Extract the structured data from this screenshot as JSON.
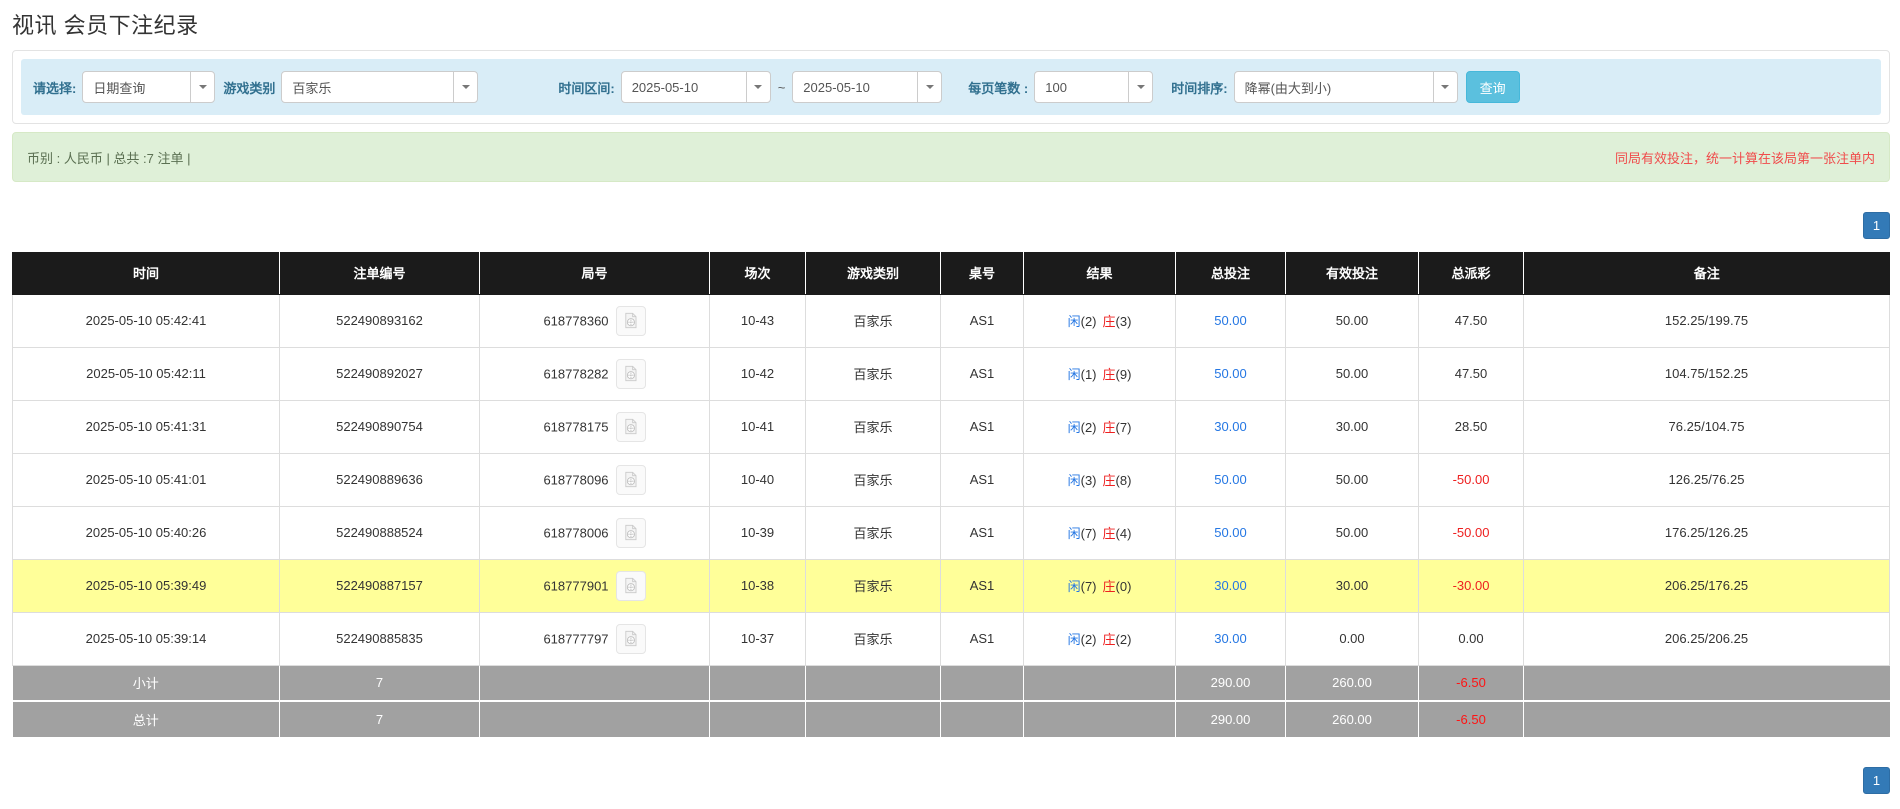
{
  "page": {
    "title": "视讯 会员下注纪录"
  },
  "filters": {
    "query_mode_label": "请选择:",
    "query_mode_value": "日期查询",
    "game_type_label": "游戏类别",
    "game_type_value": "百家乐",
    "time_range_label": "时间区间:",
    "date_from": "2025-05-10",
    "date_separator": "~",
    "date_to": "2025-05-10",
    "page_size_label": "每页笔数 :",
    "page_size_value": "100",
    "sort_label": "时间排序:",
    "sort_value": "降幂(由大到小)",
    "search_button": "查询"
  },
  "summary_bar": {
    "left_text": "币别 : 人民币 | 总共 :7 注单 |",
    "right_text": "同局有效投注，统一计算在该局第一张注单内"
  },
  "pagination": {
    "current_page": "1"
  },
  "table": {
    "headers": [
      "时间",
      "注单编号",
      "局号",
      "场次",
      "游戏类别",
      "桌号",
      "结果",
      "总投注",
      "有效投注",
      "总派彩",
      "备注"
    ],
    "rows": [
      {
        "time": "2025-05-10 05:42:41",
        "bet_no": "522490893162",
        "round_no": "618778360",
        "session": "10-43",
        "game": "百家乐",
        "table_no": "AS1",
        "player": "闲",
        "player_pts": "(2)",
        "banker": "庄",
        "banker_pts": "(3)",
        "total_bet": "50.00",
        "valid_bet": "50.00",
        "payout": "47.50",
        "payout_neg": false,
        "remark": "152.25/199.75",
        "highlight": false
      },
      {
        "time": "2025-05-10 05:42:11",
        "bet_no": "522490892027",
        "round_no": "618778282",
        "session": "10-42",
        "game": "百家乐",
        "table_no": "AS1",
        "player": "闲",
        "player_pts": "(1)",
        "banker": "庄",
        "banker_pts": "(9)",
        "total_bet": "50.00",
        "valid_bet": "50.00",
        "payout": "47.50",
        "payout_neg": false,
        "remark": "104.75/152.25",
        "highlight": false
      },
      {
        "time": "2025-05-10 05:41:31",
        "bet_no": "522490890754",
        "round_no": "618778175",
        "session": "10-41",
        "game": "百家乐",
        "table_no": "AS1",
        "player": "闲",
        "player_pts": "(2)",
        "banker": "庄",
        "banker_pts": "(7)",
        "total_bet": "30.00",
        "valid_bet": "30.00",
        "payout": "28.50",
        "payout_neg": false,
        "remark": "76.25/104.75",
        "highlight": false
      },
      {
        "time": "2025-05-10 05:41:01",
        "bet_no": "522490889636",
        "round_no": "618778096",
        "session": "10-40",
        "game": "百家乐",
        "table_no": "AS1",
        "player": "闲",
        "player_pts": "(3)",
        "banker": "庄",
        "banker_pts": "(8)",
        "total_bet": "50.00",
        "valid_bet": "50.00",
        "payout": "-50.00",
        "payout_neg": true,
        "remark": "126.25/76.25",
        "highlight": false
      },
      {
        "time": "2025-05-10 05:40:26",
        "bet_no": "522490888524",
        "round_no": "618778006",
        "session": "10-39",
        "game": "百家乐",
        "table_no": "AS1",
        "player": "闲",
        "player_pts": "(7)",
        "banker": "庄",
        "banker_pts": "(4)",
        "total_bet": "50.00",
        "valid_bet": "50.00",
        "payout": "-50.00",
        "payout_neg": true,
        "remark": "176.25/126.25",
        "highlight": false
      },
      {
        "time": "2025-05-10 05:39:49",
        "bet_no": "522490887157",
        "round_no": "618777901",
        "session": "10-38",
        "game": "百家乐",
        "table_no": "AS1",
        "player": "闲",
        "player_pts": "(7)",
        "banker": "庄",
        "banker_pts": "(0)",
        "total_bet": "30.00",
        "valid_bet": "30.00",
        "payout": "-30.00",
        "payout_neg": true,
        "remark": "206.25/176.25",
        "highlight": true
      },
      {
        "time": "2025-05-10 05:39:14",
        "bet_no": "522490885835",
        "round_no": "618777797",
        "session": "10-37",
        "game": "百家乐",
        "table_no": "AS1",
        "player": "闲",
        "player_pts": "(2)",
        "banker": "庄",
        "banker_pts": "(2)",
        "total_bet": "30.00",
        "valid_bet": "0.00",
        "payout": "0.00",
        "payout_neg": false,
        "remark": "206.25/206.25",
        "highlight": false
      }
    ],
    "subtotal": {
      "label": "小计",
      "count": "7",
      "total_bet": "290.00",
      "valid_bet": "260.00",
      "payout": "-6.50"
    },
    "grandtotal": {
      "label": "总计",
      "count": "7",
      "total_bet": "290.00",
      "valid_bet": "260.00",
      "payout": "-6.50"
    }
  },
  "colors": {
    "header_bg": "#1b1b1b",
    "highlight_row": "#ffff99",
    "summary_row_bg": "#a1a1a1",
    "link_blue": "#2577e3",
    "player_blue": "#2577e3",
    "banker_red": "#ee2020",
    "negative_red": "#ee2020",
    "alert_note_red": "#f04c4c",
    "filter_bar_bg": "#d9edf7",
    "green_bar_bg": "#dff0d8",
    "search_button_bg": "#5bc0de",
    "pagination_bg": "#337ab7"
  }
}
